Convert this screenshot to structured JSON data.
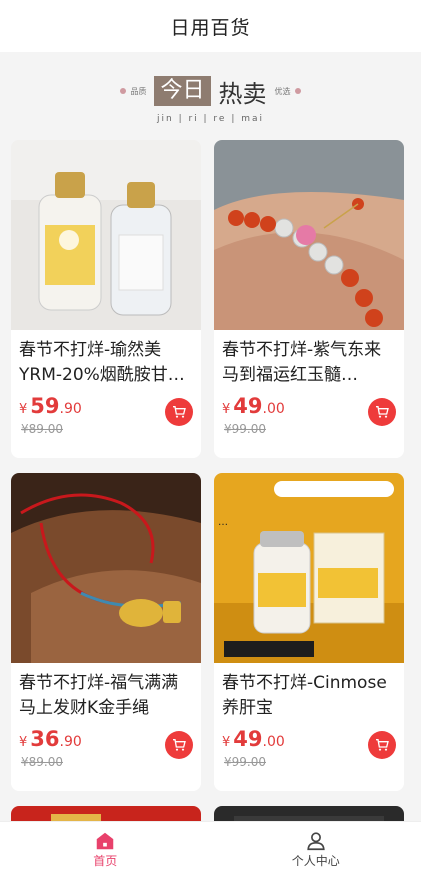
{
  "header": {
    "title": "日用百货"
  },
  "banner": {
    "today": "今日",
    "hot": "热卖",
    "left_tag": "品质",
    "right_tag": "优选",
    "pinyin": "jin  |  ri  |  re  |  mai"
  },
  "products": [
    {
      "name": "春节不打烊-瑜然美YRM-20%烟酰胺甘…",
      "currency": "¥",
      "price_int": "59",
      "price_dec": ".90",
      "original": "¥89.00",
      "image": "bottles"
    },
    {
      "name": "春节不打烊-紫气东来马到福运红玉髓…",
      "currency": "¥",
      "price_int": "49",
      "price_dec": ".00",
      "original": "¥99.00",
      "image": "bracelet"
    },
    {
      "name": "春节不打烊-福气满满马上发财K金手绳",
      "currency": "¥",
      "price_int": "36",
      "price_dec": ".90",
      "original": "¥89.00",
      "image": "red-rope"
    },
    {
      "name": "春节不打烊-Cinmose养肝宝",
      "currency": "¥",
      "price_int": "49",
      "price_dec": ".00",
      "original": "¥99.00",
      "image": "supplement"
    }
  ],
  "tabbar": {
    "home": "首页",
    "profile": "个人中心"
  },
  "colors": {
    "accent": "#e8416b",
    "price": "#e23b3b",
    "cart": "#ee3b3b"
  }
}
